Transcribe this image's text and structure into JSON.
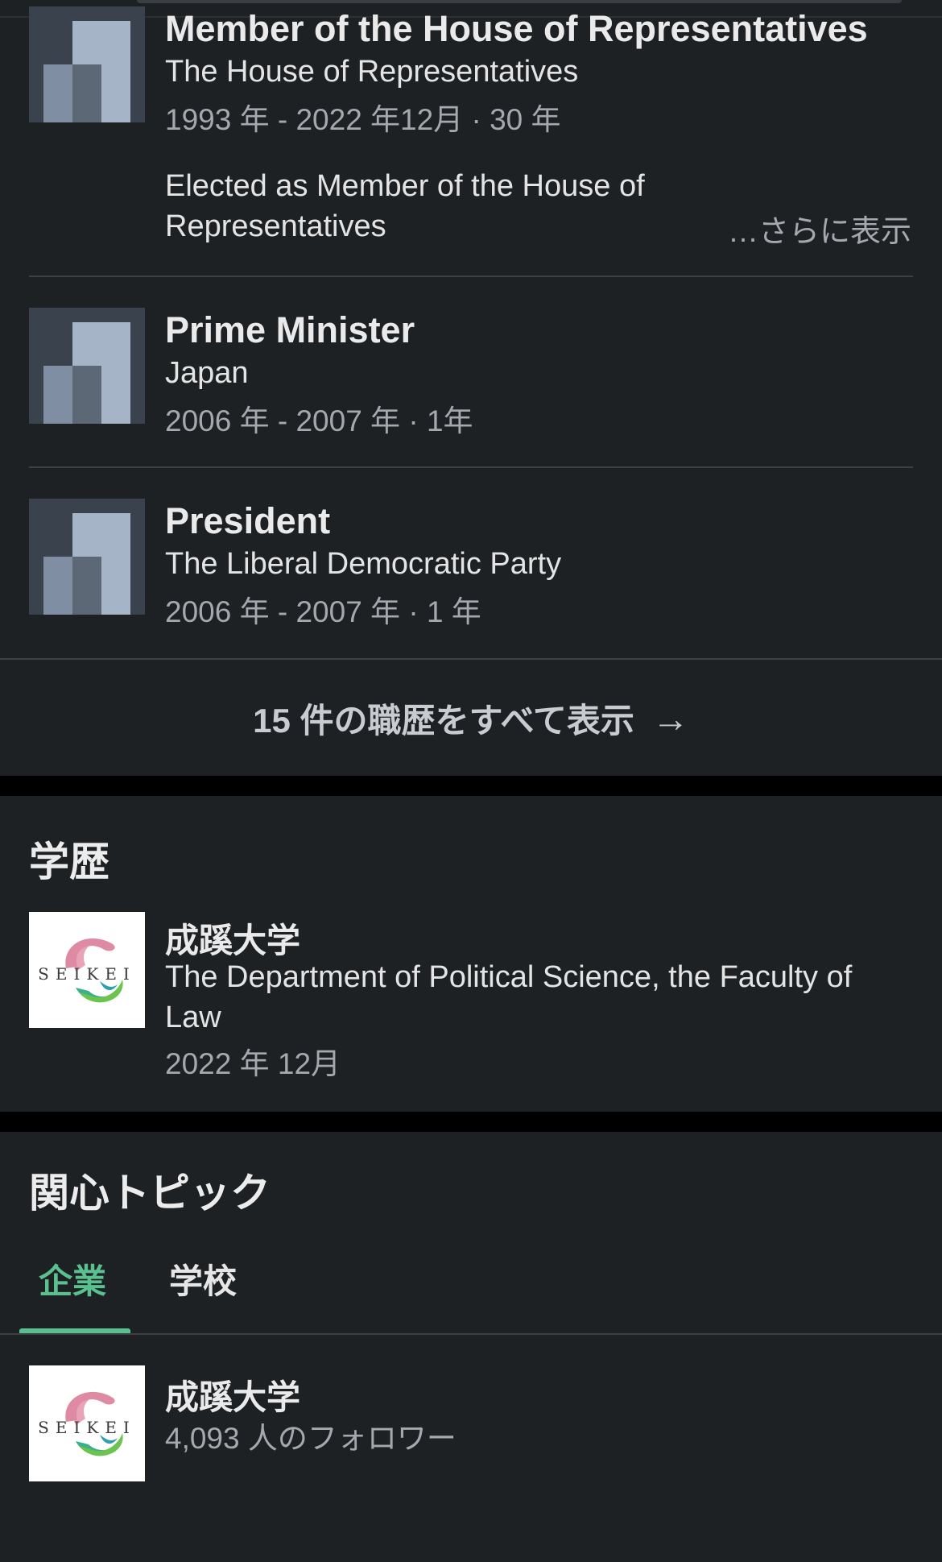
{
  "experience": {
    "items": [
      {
        "title": "Member of the House of Representatives",
        "org": "The House of Representatives",
        "dates": "1993 年 - 2022 年12月 · 30 年",
        "description": "Elected as Member of the House of Representatives",
        "see_more": "…さらに表示"
      },
      {
        "title": "Prime Minister",
        "org": "Japan",
        "dates": "2006 年 - 2007 年 · 1年"
      },
      {
        "title": "President",
        "org": "The Liberal Democratic Party",
        "dates": "2006 年 - 2007 年 · 1 年"
      }
    ],
    "show_all_label": "15 件の職歴をすべて表示",
    "show_all_arrow": "→"
  },
  "education": {
    "title": "学歴",
    "school": "成蹊大学",
    "degree": "The Department of Political Science, the Faculty of Law",
    "date": "2022 年 12月",
    "logo_text": "SEIKEI"
  },
  "interests": {
    "title": "関心トピック",
    "tabs": [
      {
        "label": "企業",
        "active": true
      },
      {
        "label": "学校",
        "active": false
      }
    ],
    "item": {
      "name": "成蹊大学",
      "followers": "4,093 人のフォロワー",
      "logo_text": "SEIKEI"
    }
  },
  "colors": {
    "background": "#1e2124",
    "section_gap": "#000000",
    "accent_green": "#5ac08f",
    "muted_text": "#a5a8ac"
  }
}
